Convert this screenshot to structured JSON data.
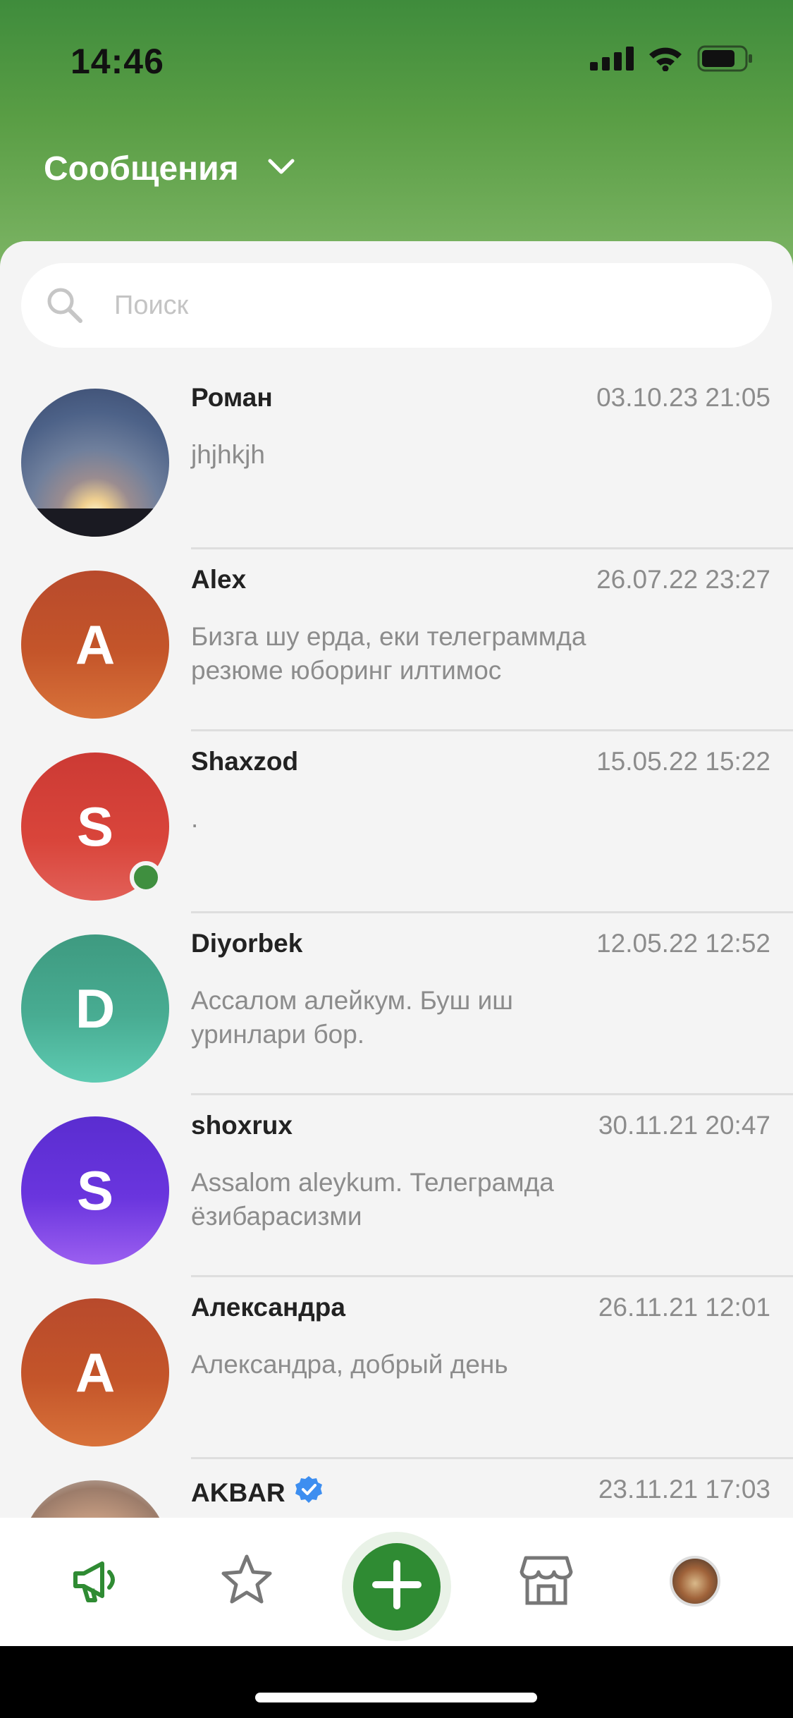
{
  "status_bar": {
    "time": "14:46"
  },
  "header": {
    "title": "Сообщения"
  },
  "search": {
    "placeholder": "Поиск"
  },
  "conversations": [
    {
      "name": "Роман",
      "date": "03.10.23 21:05",
      "message": "jhjhkjh",
      "avatar_letter": ""
    },
    {
      "name": "Alex",
      "date": "26.07.22 23:27",
      "message": "Бизга шу ерда, еки телеграммда резюме юборинг илтимос",
      "avatar_letter": "A"
    },
    {
      "name": "Shaxzod",
      "date": "15.05.22 15:22",
      "message": ".",
      "avatar_letter": "S",
      "online": true
    },
    {
      "name": "Diyorbek",
      "date": "12.05.22 12:52",
      "message": "Ассалом алейкум. Буш иш уринлари бор.",
      "avatar_letter": "D"
    },
    {
      "name": "shoxrux",
      "date": "30.11.21 20:47",
      "message": "Assalom aleykum. Телеграмда ёзибарасизми",
      "avatar_letter": "S"
    },
    {
      "name": "Александра",
      "date": "26.11.21 12:01",
      "message": "Александра, добрый день",
      "avatar_letter": "A"
    },
    {
      "name": "AKBAR",
      "date": "23.11.21 17:03",
      "message": "",
      "avatar_letter": "",
      "verified": true
    }
  ],
  "tabbar": {
    "items": [
      {
        "icon": "megaphone-icon",
        "active": true
      },
      {
        "icon": "star-icon"
      },
      {
        "icon": "plus-icon"
      },
      {
        "icon": "store-icon"
      },
      {
        "icon": "profile-avatar"
      }
    ]
  },
  "colors": {
    "brand_green": "#2f8b33",
    "header_gradient_top": "#3f8c3c",
    "header_gradient_bottom": "#7cb464",
    "online_dot": "#3f8f3f",
    "verified_badge": "#3d8ef0"
  }
}
